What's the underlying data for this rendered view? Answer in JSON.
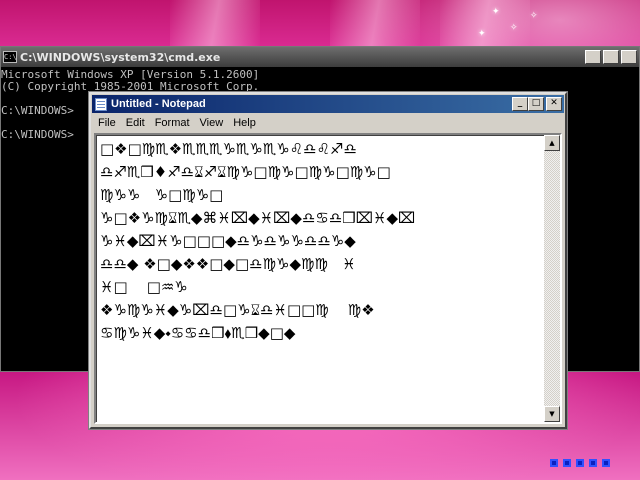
{
  "cmd": {
    "title": "C:\\WINDOWS\\system32\\cmd.exe",
    "icon": "C:\\",
    "lines": [
      "Microsoft Windows XP [Version 5.1.2600]",
      "(C) Copyright 1985-2001 Microsoft Corp.",
      "",
      "C:\\WINDOWS>",
      "",
      "C:\\WINDOWS>"
    ]
  },
  "notepad": {
    "title": "Untitled - Notepad",
    "menu": [
      "File",
      "Edit",
      "Format",
      "View",
      "Help"
    ],
    "buttons": {
      "minimize": "_",
      "maximize": "□",
      "close": "✕"
    },
    "text_lines": [
      "□❖□♍︎♏︎❖♏︎♏︎♏︎♑︎♏︎♑︎♏︎♑︎♌︎♎︎♌︎♐︎♎︎",
      "♎︎♐︎♏︎❒♦︎♐︎♎︎⌛︎♐︎⌛︎♍︎♑︎□♍︎♑︎□♍︎♑︎□♍︎♑︎□",
      "♍︎♑︎♑︎   ♑︎□♍︎♑︎□",
      "♑︎□❖♑︎♍︎⌛︎♏︎◆⌘♓︎⌧◆♓︎⌧◆♎︎♋︎♎︎❒⌧♓︎◆⌧",
      "♑︎♓︎◆⌧♓︎♑︎□□□◆♎︎♑︎♎︎♑︎♑︎♎︎♎︎♑︎◆",
      "♎︎♎︎◆ ❖□◆❖❖□◆□♎︎♍︎♑︎◆♍︎♍︎   ♓︎",
      "♓︎□    □♒︎♑︎",
      "❖♑︎♍︎♑︎♓︎◆♑︎⌧♎︎□♑︎⌛︎♎︎♓︎□□♍︎    ♍︎❖",
      "♋︎♍︎♑︎♓︎◆⬩♋︎♋︎♎︎❒⬧♏︎❒◆□◆",
      "",
      "",
      ""
    ],
    "scroll_up_arrow": "▲",
    "scroll_down_arrow": "▼"
  },
  "desktop": {
    "pager_dots": 5,
    "colors": {
      "wallpaper_main": "#c0146e",
      "titlebar": "#0a246a",
      "pager": "#0a20c0"
    }
  }
}
